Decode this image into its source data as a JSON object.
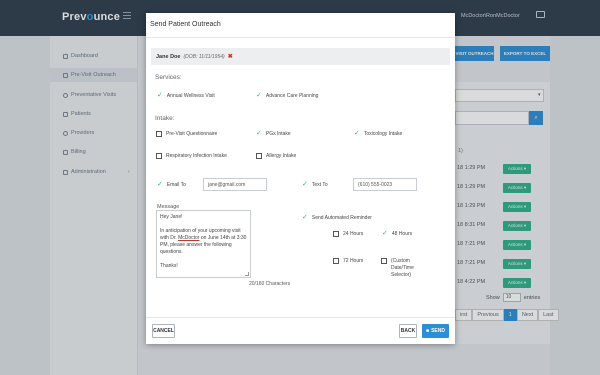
{
  "app": {
    "logo_prefix": "Prev",
    "logo_accent": "o",
    "logo_suffix": "unce",
    "user_name": "McDoctor\\RonMcDoctor"
  },
  "sidebar": {
    "items": [
      {
        "label": "Dashboard",
        "icon": "home-icon"
      },
      {
        "label": "Pre-Visit Outreach",
        "icon": "chat-icon"
      },
      {
        "label": "Preventative Visits",
        "icon": "shield-icon"
      },
      {
        "label": "Patients",
        "icon": "users-icon"
      },
      {
        "label": "Providers",
        "icon": "user-icon"
      },
      {
        "label": "Billing",
        "icon": "billing-icon"
      },
      {
        "label": "Administration",
        "icon": "wrench-icon",
        "chevron": "‹"
      }
    ]
  },
  "background": {
    "visit_outreach_button": "VISIT OUTREACH",
    "export_button": "EXPORT TO EXCEL",
    "column_header": "1)",
    "rows": [
      {
        "time": "18 1:29 PM",
        "action": "Actions ▾"
      },
      {
        "time": "18 1:29 PM",
        "action": "Actions ▾"
      },
      {
        "time": "18 1:29 PM",
        "action": "Actions ▾"
      },
      {
        "time": "18 8:31 PM",
        "action": "Actions ▾"
      },
      {
        "time": "18 7:21 PM",
        "action": "Actions ▾"
      },
      {
        "time": "18 7:21 PM",
        "action": "Actions ▾"
      },
      {
        "time": "18 4:22 PM",
        "action": "Actions ▾"
      }
    ],
    "show_label": "Show",
    "show_value": "10",
    "entries_label": "entries",
    "pager": [
      "irst",
      "Previous",
      "1",
      "Next",
      "Last"
    ],
    "pager_active": "1"
  },
  "modal": {
    "title": "Send Patient Outreach",
    "close": "×",
    "patient": {
      "name": "Jane Doe",
      "dob": "(DOB: 11/11/1954)",
      "remove": "✖"
    },
    "services_title": "Services:",
    "services": [
      {
        "label": "Annual Wellness Visit",
        "checked": true
      },
      {
        "label": "Advance Care Planning",
        "checked": true
      }
    ],
    "intake_title": "Intake:",
    "intake": [
      {
        "label": "Pre-Visit Questionnaire",
        "checked": false
      },
      {
        "label": "PGx Intake",
        "checked": true
      },
      {
        "label": "Toxicology Intake",
        "checked": true
      },
      {
        "label": "Respiratory Infection Intake",
        "checked": false
      },
      {
        "label": "Allergy Intake",
        "checked": false
      }
    ],
    "email": {
      "label": "Email To",
      "value": "jane@gmail.com",
      "checked": true
    },
    "text": {
      "label": "Text To",
      "value": "(610) 555-0023",
      "checked": true
    },
    "message_label": "Message",
    "message": {
      "greeting": "Hey Jane!",
      "body_before": "In anticipation of your upcoming visit with Dr.",
      "body_name": "McDoctor",
      "body_after": "on June 14th at 3:30 PM, please answer the following questions.",
      "signoff": "Thanks!"
    },
    "char_count": "20/160 Characters",
    "reminder": {
      "label": "Send Automated Reminder",
      "checked": true,
      "options": [
        {
          "label": "24 Hours",
          "checked": false
        },
        {
          "label": "48 Hours",
          "checked": true
        },
        {
          "label": "72 Hours",
          "checked": false
        },
        {
          "label": "(Custom Date/Time Selector)",
          "checked": false
        }
      ]
    },
    "buttons": {
      "cancel": "CANCEL",
      "back": "BACK",
      "send": "SEND"
    }
  },
  "colors": {
    "accent": "#2c8fd6",
    "check": "#2fb38a",
    "danger": "#d0312d",
    "topbar": "#2f3c4c"
  }
}
